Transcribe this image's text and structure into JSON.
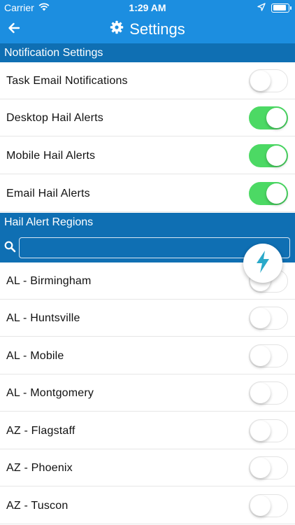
{
  "status_bar": {
    "carrier": "Carrier",
    "time": "1:29 AM",
    "icons": [
      "wifi-icon",
      "location-arrow-icon",
      "battery-icon"
    ]
  },
  "nav": {
    "title": "Settings",
    "back_icon": "back-arrow-icon",
    "title_icon": "gear-icon"
  },
  "notification_section": {
    "header": "Notification Settings",
    "items": [
      {
        "label": "Task Email Notifications",
        "on": false
      },
      {
        "label": "Desktop Hail Alerts",
        "on": true
      },
      {
        "label": "Mobile Hail Alerts",
        "on": true
      },
      {
        "label": "Email Hail Alerts",
        "on": true
      }
    ]
  },
  "regions_section": {
    "header": "Hail Alert Regions",
    "search": {
      "value": "",
      "placeholder": ""
    },
    "items": [
      {
        "label": "AL - Birmingham",
        "on": false
      },
      {
        "label": "AL - Huntsville",
        "on": false
      },
      {
        "label": "AL - Mobile",
        "on": false
      },
      {
        "label": "AL - Montgomery",
        "on": false
      },
      {
        "label": "AZ - Flagstaff",
        "on": false
      },
      {
        "label": "AZ - Phoenix",
        "on": false
      },
      {
        "label": "AZ - Tuscon",
        "on": false
      }
    ]
  },
  "fab": {
    "icon": "lightning-bolt-icon"
  },
  "colors": {
    "nav_blue": "#1c8ee0",
    "section_blue": "#0f6fb3",
    "toggle_on": "#4cd964",
    "fab_bolt": "#2aa9c9"
  }
}
